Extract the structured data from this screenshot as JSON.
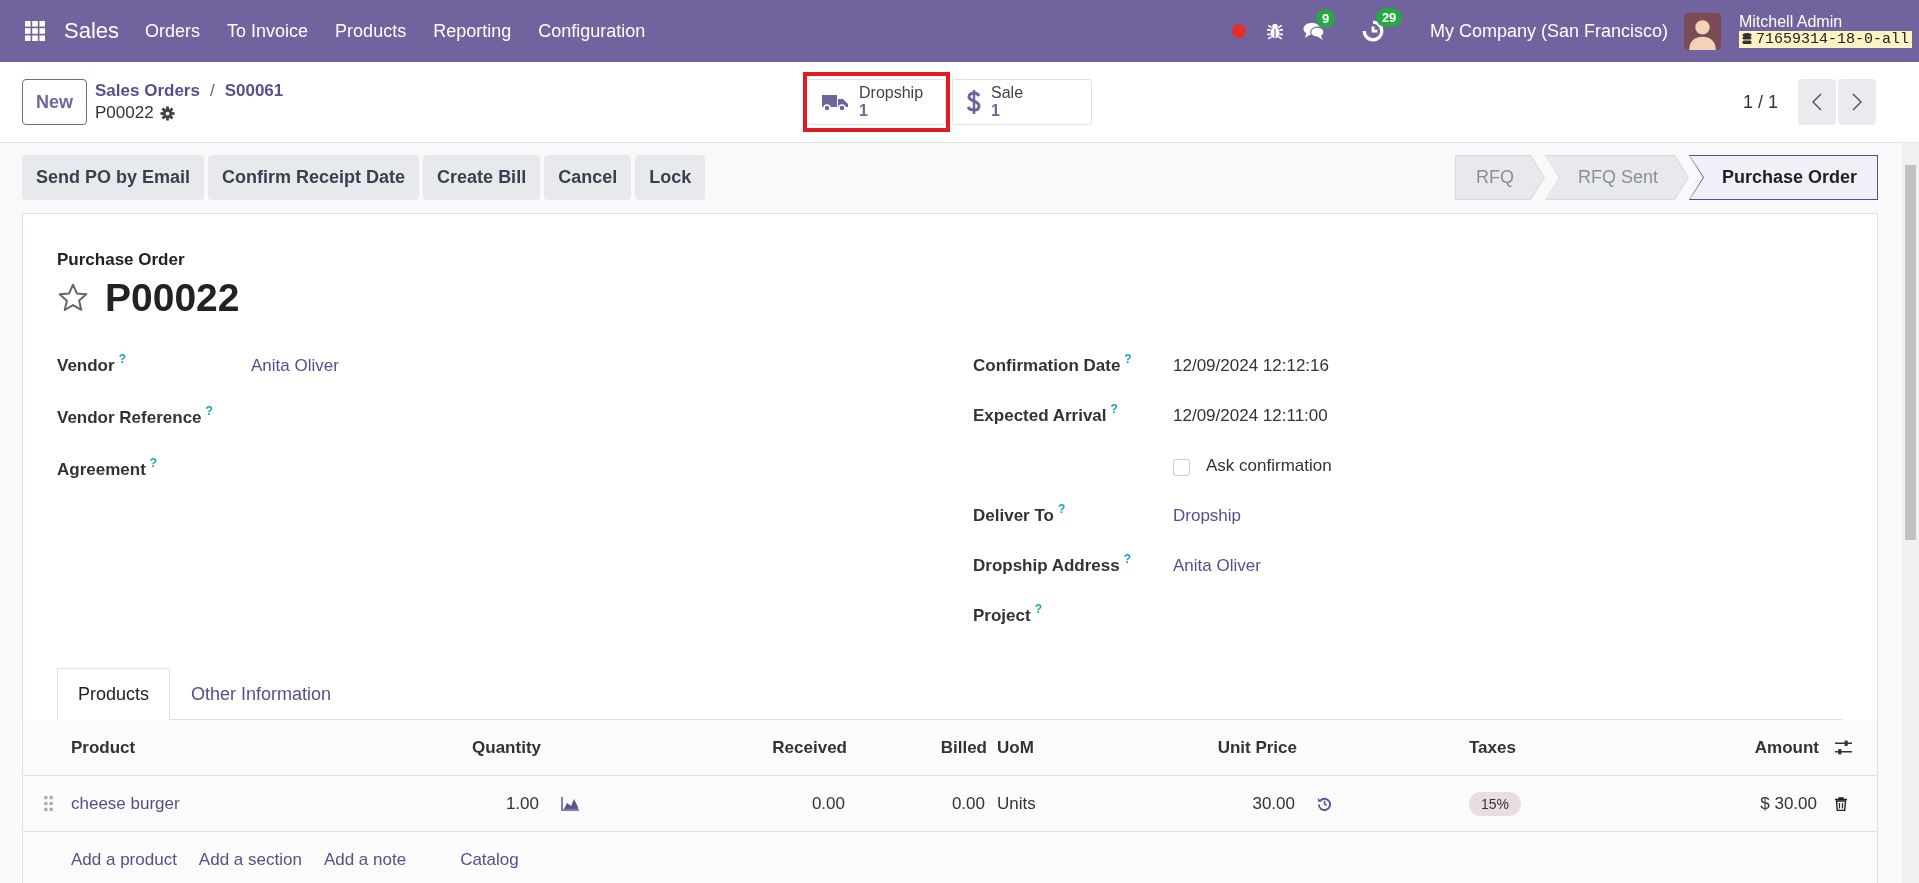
{
  "navbar": {
    "app": "Sales",
    "menu": [
      "Orders",
      "To Invoice",
      "Products",
      "Reporting",
      "Configuration"
    ],
    "messages_count": "9",
    "activities_count": "29",
    "company": "My Company (San Francisco)",
    "user": "Mitchell Admin",
    "database": "71659314-18-0-all"
  },
  "control_panel": {
    "new_button": "New",
    "breadcrumbs": [
      "Sales Orders",
      "S00061"
    ],
    "breadcrumb_separator": "/",
    "record": "P00022",
    "smart_buttons": [
      {
        "kind": "truck",
        "label": "Dropship",
        "value": "1",
        "highlighted": true
      },
      {
        "kind": "dollar",
        "label": "Sale",
        "value": "1",
        "highlighted": false
      }
    ],
    "pager": "1 / 1"
  },
  "actions": [
    "Send PO by Email",
    "Confirm Receipt Date",
    "Create Bill",
    "Cancel",
    "Lock"
  ],
  "statusbar": [
    {
      "label": "RFQ",
      "selected": false
    },
    {
      "label": "RFQ Sent",
      "selected": false
    },
    {
      "label": "Purchase Order",
      "selected": true
    }
  ],
  "form": {
    "title_label": "Purchase Order",
    "name": "P00022",
    "starred": false,
    "left_fields": [
      {
        "label": "Vendor",
        "help": "?",
        "value": "Anita Oliver"
      },
      {
        "label": "Vendor Reference",
        "help": "?"
      },
      {
        "label": "Agreement",
        "help": "?"
      }
    ],
    "right_fields": [
      {
        "kind": "field",
        "label": "Confirmation Date",
        "help": "?",
        "value": "12/09/2024 12:12:16",
        "plain": true
      },
      {
        "kind": "field",
        "label": "Expected Arrival",
        "help": "?",
        "value": "12/09/2024 12:11:00",
        "plain": true
      },
      {
        "kind": "checkbox",
        "label": "Ask confirmation",
        "checked": false
      },
      {
        "kind": "field",
        "label": "Deliver To",
        "help": "?",
        "value": "Dropship",
        "plain": false
      },
      {
        "kind": "field",
        "label": "Dropship Address",
        "help": "?",
        "value": "Anita Oliver",
        "plain": false
      },
      {
        "kind": "field",
        "label": "Project",
        "help": "?"
      }
    ]
  },
  "tabs": [
    {
      "label": "Products",
      "selected": true
    },
    {
      "label": "Other Information",
      "selected": false
    }
  ],
  "table": {
    "columns": [
      "Product",
      "Quantity",
      "Received",
      "Billed",
      "UoM",
      "Unit Price",
      "Taxes",
      "Amount"
    ],
    "rows": [
      {
        "product": "cheese burger",
        "quantity": "1.00",
        "received": "0.00",
        "billed": "0.00",
        "uom": "Units",
        "unit_price": "30.00",
        "taxes": [
          "15%"
        ],
        "amount": "$ 30.00"
      }
    ],
    "add_links": [
      "Add a product",
      "Add a section",
      "Add a note",
      "Catalog"
    ]
  }
}
